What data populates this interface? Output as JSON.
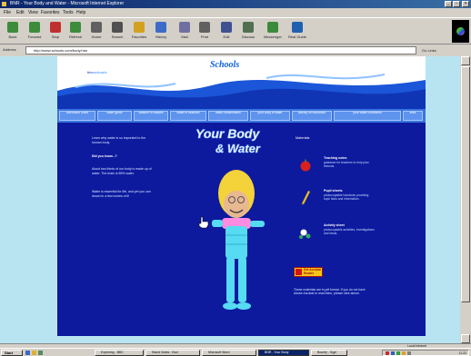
{
  "window": {
    "title": "BNR - Your Body and Water - Microsoft Internet Explorer"
  },
  "menu": [
    "File",
    "Edit",
    "View",
    "Favorites",
    "Tools",
    "Help"
  ],
  "toolbar": [
    {
      "label": "Back",
      "icon": "back-arrow-icon",
      "color": "#3c8c3c"
    },
    {
      "label": "Forward",
      "icon": "forward-arrow-icon",
      "color": "#3c8c3c"
    },
    {
      "label": "Stop",
      "icon": "stop-icon",
      "color": "#c03030"
    },
    {
      "label": "Refresh",
      "icon": "refresh-icon",
      "color": "#3c8c3c"
    },
    {
      "label": "Home",
      "icon": "home-icon",
      "color": "#606060"
    },
    {
      "label": "Search",
      "icon": "search-icon",
      "color": "#505050"
    },
    {
      "label": "Favorites",
      "icon": "favorites-icon",
      "color": "#d4a020"
    },
    {
      "label": "History",
      "icon": "history-icon",
      "color": "#3c6cc8"
    },
    {
      "label": "Mail",
      "icon": "mail-icon",
      "color": "#7070a0"
    },
    {
      "label": "Print",
      "icon": "print-icon",
      "color": "#606060"
    },
    {
      "label": "Edit",
      "icon": "edit-icon",
      "color": "#405090"
    },
    {
      "label": "Discuss",
      "icon": "discuss-icon",
      "color": "#507050"
    },
    {
      "label": "Messenger",
      "icon": "messenger-icon",
      "color": "#3a8a3a"
    },
    {
      "label": "Real Guide",
      "icon": "real-guide-icon",
      "color": "#2060b0"
    }
  ],
  "address": {
    "label": "Address",
    "url": "http://www.schools.com/body.htm",
    "go_label": "Go  Links"
  },
  "page": {
    "brand_prefix": "bbc",
    "brand_name": "schools",
    "site_logo": "Schools",
    "nav": [
      "curriculum notes",
      "water game",
      "weather in classes",
      "water in beaches",
      "water conservation",
      "your body in water",
      "activity on resources",
      "your water comments",
      "links"
    ],
    "intro": "Learn why water is so important to the human body.",
    "question": "Did you know...?",
    "fact_one": "About two thirds of our body is made up of water. The brain is 85% water.",
    "fact_two": "Water is essential for life, and yet you can drown in a few inches of it!",
    "title_line1": "Your Body",
    "title_line2": "& Water",
    "resources_title": "Materials",
    "resources": [
      {
        "heading": "Teaching notes",
        "body": "guidance for teachers to help plan lessons.",
        "icon": "apple-icon",
        "color": "#d82020"
      },
      {
        "heading": "Pupil sheets",
        "body": "photocopiable handouts providing topic facts and information.",
        "icon": "pencil-icon",
        "color": "#e8c020"
      },
      {
        "heading": "Activity sheet",
        "body": "photocopiable activities, investigations and ideas.",
        "icon": "molecule-icon",
        "color": "#30b060"
      }
    ],
    "pdf_badge": "Get Acrobat Reader",
    "pdf_note": "These materials are in pdf format. If you do not have Adobe Acrobat to read them, please click above."
  },
  "status": {
    "zone": "Local intranet"
  },
  "taskbar": {
    "start": "Start",
    "tasks": [
      {
        "label": "Exploring - BBC",
        "active": false
      },
      {
        "label": "Stand Notes - Bod",
        "active": false
      },
      {
        "label": "Microsoft Word",
        "active": false
      },
      {
        "label": "BNR - Your Body",
        "active": true
      },
      {
        "label": "Bounty - Sqpl",
        "active": false
      }
    ],
    "clock": "11:22"
  }
}
